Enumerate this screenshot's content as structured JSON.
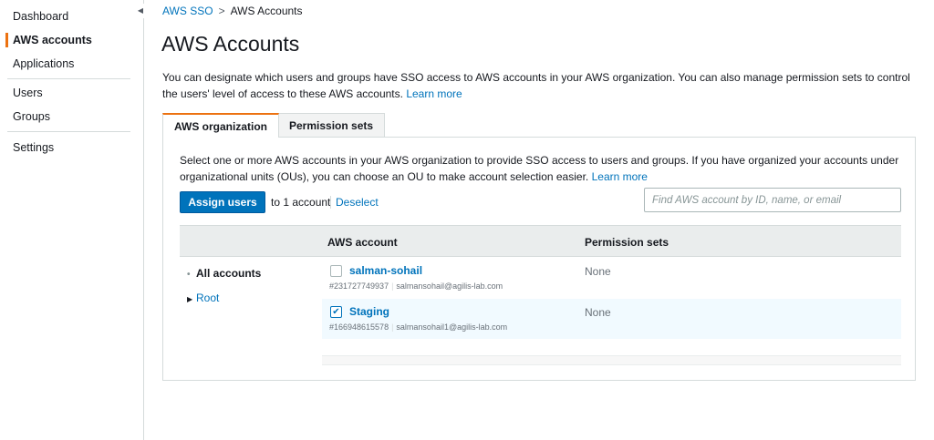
{
  "sidebar": {
    "items": [
      {
        "label": "Dashboard"
      },
      {
        "label": "AWS accounts"
      },
      {
        "label": "Applications"
      },
      {
        "label": "Users"
      },
      {
        "label": "Groups"
      },
      {
        "label": "Settings"
      }
    ],
    "collapse_glyph": "◀"
  },
  "breadcrumb": {
    "root": "AWS SSO",
    "separator": ">",
    "current": "AWS Accounts"
  },
  "page": {
    "title": "AWS Accounts",
    "intro": "You can designate which users and groups have SSO access to AWS accounts in your AWS organization. You can also manage permission sets to control the users' level of access to these AWS accounts.",
    "learn_more": "Learn more"
  },
  "tabs": [
    {
      "label": "AWS organization",
      "active": true
    },
    {
      "label": "Permission sets",
      "active": false
    }
  ],
  "panel": {
    "description": "Select one or more AWS accounts in your AWS organization to provide SSO access to users and groups. If you have organized your accounts under organizational units (OUs), you can choose an OU to make account selection easier.",
    "learn_more": "Learn more",
    "assign_button": "Assign users",
    "assign_suffix": "to 1 account",
    "deselect": "Deselect",
    "search_placeholder": "Find AWS account by ID, name, or email"
  },
  "table": {
    "columns": [
      "AWS account",
      "Permission sets"
    ],
    "tree": [
      {
        "label": "All accounts",
        "type": "bullet"
      },
      {
        "label": "Root",
        "type": "expand"
      }
    ],
    "rows": [
      {
        "name": "salman-sohail",
        "id": "#231727749937",
        "email": "salmansohail@agilis-lab.com",
        "permission": "None",
        "checked": false
      },
      {
        "name": "Staging",
        "id": "#166948615578",
        "email": "salmansohail1@agilis-lab.com",
        "permission": "None",
        "checked": true
      }
    ]
  },
  "colors": {
    "accent": "#ec7211",
    "link": "#0073bb",
    "selected_row": "#f1faff"
  }
}
